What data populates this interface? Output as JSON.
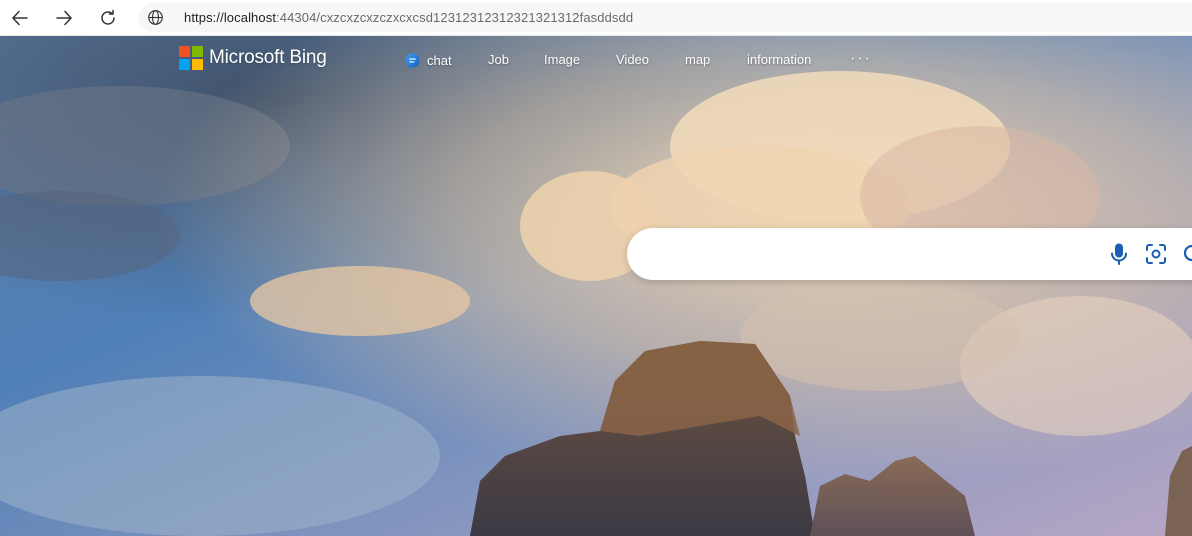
{
  "browser": {
    "url_host": "https://localhost",
    "url_rest": ":44304/cxzcxzcxzczxcxcsd12312312312321321312fasddsdd"
  },
  "bing": {
    "logo_text": "Microsoft Bing",
    "logo_colors": [
      "#f25022",
      "#7fba00",
      "#00a4ef",
      "#ffb900"
    ],
    "nav": {
      "chat": "chat",
      "job": "Job",
      "image": "Image",
      "video": "Video",
      "map": "map",
      "information": "information",
      "more": "···"
    },
    "search": {
      "value": "",
      "placeholder": ""
    },
    "accent_color": "#1a5fb4"
  }
}
